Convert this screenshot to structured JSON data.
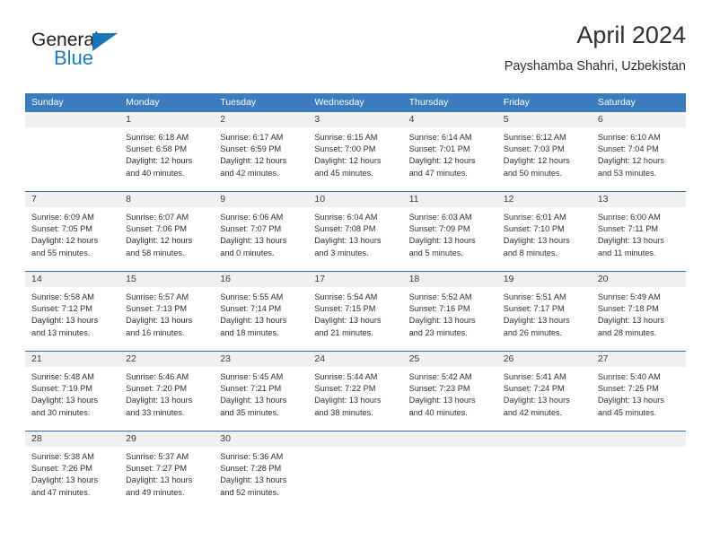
{
  "brand": {
    "name_part1": "General",
    "name_part2": "Blue",
    "accent_color": "#1b72b8"
  },
  "header": {
    "title": "April 2024",
    "subtitle": "Payshamba Shahri, Uzbekistan"
  },
  "calendar": {
    "header_color": "#3a7cbe",
    "weekdays": [
      "Sunday",
      "Monday",
      "Tuesday",
      "Wednesday",
      "Thursday",
      "Friday",
      "Saturday"
    ],
    "weeks": [
      [
        {
          "day": "",
          "sunrise": "",
          "sunset": "",
          "daylight_line1": "",
          "daylight_line2": ""
        },
        {
          "day": "1",
          "sunrise": "Sunrise: 6:18 AM",
          "sunset": "Sunset: 6:58 PM",
          "daylight_line1": "Daylight: 12 hours",
          "daylight_line2": "and 40 minutes."
        },
        {
          "day": "2",
          "sunrise": "Sunrise: 6:17 AM",
          "sunset": "Sunset: 6:59 PM",
          "daylight_line1": "Daylight: 12 hours",
          "daylight_line2": "and 42 minutes."
        },
        {
          "day": "3",
          "sunrise": "Sunrise: 6:15 AM",
          "sunset": "Sunset: 7:00 PM",
          "daylight_line1": "Daylight: 12 hours",
          "daylight_line2": "and 45 minutes."
        },
        {
          "day": "4",
          "sunrise": "Sunrise: 6:14 AM",
          "sunset": "Sunset: 7:01 PM",
          "daylight_line1": "Daylight: 12 hours",
          "daylight_line2": "and 47 minutes."
        },
        {
          "day": "5",
          "sunrise": "Sunrise: 6:12 AM",
          "sunset": "Sunset: 7:03 PM",
          "daylight_line1": "Daylight: 12 hours",
          "daylight_line2": "and 50 minutes."
        },
        {
          "day": "6",
          "sunrise": "Sunrise: 6:10 AM",
          "sunset": "Sunset: 7:04 PM",
          "daylight_line1": "Daylight: 12 hours",
          "daylight_line2": "and 53 minutes."
        }
      ],
      [
        {
          "day": "7",
          "sunrise": "Sunrise: 6:09 AM",
          "sunset": "Sunset: 7:05 PM",
          "daylight_line1": "Daylight: 12 hours",
          "daylight_line2": "and 55 minutes."
        },
        {
          "day": "8",
          "sunrise": "Sunrise: 6:07 AM",
          "sunset": "Sunset: 7:06 PM",
          "daylight_line1": "Daylight: 12 hours",
          "daylight_line2": "and 58 minutes."
        },
        {
          "day": "9",
          "sunrise": "Sunrise: 6:06 AM",
          "sunset": "Sunset: 7:07 PM",
          "daylight_line1": "Daylight: 13 hours",
          "daylight_line2": "and 0 minutes."
        },
        {
          "day": "10",
          "sunrise": "Sunrise: 6:04 AM",
          "sunset": "Sunset: 7:08 PM",
          "daylight_line1": "Daylight: 13 hours",
          "daylight_line2": "and 3 minutes."
        },
        {
          "day": "11",
          "sunrise": "Sunrise: 6:03 AM",
          "sunset": "Sunset: 7:09 PM",
          "daylight_line1": "Daylight: 13 hours",
          "daylight_line2": "and 5 minutes."
        },
        {
          "day": "12",
          "sunrise": "Sunrise: 6:01 AM",
          "sunset": "Sunset: 7:10 PM",
          "daylight_line1": "Daylight: 13 hours",
          "daylight_line2": "and 8 minutes."
        },
        {
          "day": "13",
          "sunrise": "Sunrise: 6:00 AM",
          "sunset": "Sunset: 7:11 PM",
          "daylight_line1": "Daylight: 13 hours",
          "daylight_line2": "and 11 minutes."
        }
      ],
      [
        {
          "day": "14",
          "sunrise": "Sunrise: 5:58 AM",
          "sunset": "Sunset: 7:12 PM",
          "daylight_line1": "Daylight: 13 hours",
          "daylight_line2": "and 13 minutes."
        },
        {
          "day": "15",
          "sunrise": "Sunrise: 5:57 AM",
          "sunset": "Sunset: 7:13 PM",
          "daylight_line1": "Daylight: 13 hours",
          "daylight_line2": "and 16 minutes."
        },
        {
          "day": "16",
          "sunrise": "Sunrise: 5:55 AM",
          "sunset": "Sunset: 7:14 PM",
          "daylight_line1": "Daylight: 13 hours",
          "daylight_line2": "and 18 minutes."
        },
        {
          "day": "17",
          "sunrise": "Sunrise: 5:54 AM",
          "sunset": "Sunset: 7:15 PM",
          "daylight_line1": "Daylight: 13 hours",
          "daylight_line2": "and 21 minutes."
        },
        {
          "day": "18",
          "sunrise": "Sunrise: 5:52 AM",
          "sunset": "Sunset: 7:16 PM",
          "daylight_line1": "Daylight: 13 hours",
          "daylight_line2": "and 23 minutes."
        },
        {
          "day": "19",
          "sunrise": "Sunrise: 5:51 AM",
          "sunset": "Sunset: 7:17 PM",
          "daylight_line1": "Daylight: 13 hours",
          "daylight_line2": "and 26 minutes."
        },
        {
          "day": "20",
          "sunrise": "Sunrise: 5:49 AM",
          "sunset": "Sunset: 7:18 PM",
          "daylight_line1": "Daylight: 13 hours",
          "daylight_line2": "and 28 minutes."
        }
      ],
      [
        {
          "day": "21",
          "sunrise": "Sunrise: 5:48 AM",
          "sunset": "Sunset: 7:19 PM",
          "daylight_line1": "Daylight: 13 hours",
          "daylight_line2": "and 30 minutes."
        },
        {
          "day": "22",
          "sunrise": "Sunrise: 5:46 AM",
          "sunset": "Sunset: 7:20 PM",
          "daylight_line1": "Daylight: 13 hours",
          "daylight_line2": "and 33 minutes."
        },
        {
          "day": "23",
          "sunrise": "Sunrise: 5:45 AM",
          "sunset": "Sunset: 7:21 PM",
          "daylight_line1": "Daylight: 13 hours",
          "daylight_line2": "and 35 minutes."
        },
        {
          "day": "24",
          "sunrise": "Sunrise: 5:44 AM",
          "sunset": "Sunset: 7:22 PM",
          "daylight_line1": "Daylight: 13 hours",
          "daylight_line2": "and 38 minutes."
        },
        {
          "day": "25",
          "sunrise": "Sunrise: 5:42 AM",
          "sunset": "Sunset: 7:23 PM",
          "daylight_line1": "Daylight: 13 hours",
          "daylight_line2": "and 40 minutes."
        },
        {
          "day": "26",
          "sunrise": "Sunrise: 5:41 AM",
          "sunset": "Sunset: 7:24 PM",
          "daylight_line1": "Daylight: 13 hours",
          "daylight_line2": "and 42 minutes."
        },
        {
          "day": "27",
          "sunrise": "Sunrise: 5:40 AM",
          "sunset": "Sunset: 7:25 PM",
          "daylight_line1": "Daylight: 13 hours",
          "daylight_line2": "and 45 minutes."
        }
      ],
      [
        {
          "day": "28",
          "sunrise": "Sunrise: 5:38 AM",
          "sunset": "Sunset: 7:26 PM",
          "daylight_line1": "Daylight: 13 hours",
          "daylight_line2": "and 47 minutes."
        },
        {
          "day": "29",
          "sunrise": "Sunrise: 5:37 AM",
          "sunset": "Sunset: 7:27 PM",
          "daylight_line1": "Daylight: 13 hours",
          "daylight_line2": "and 49 minutes."
        },
        {
          "day": "30",
          "sunrise": "Sunrise: 5:36 AM",
          "sunset": "Sunset: 7:28 PM",
          "daylight_line1": "Daylight: 13 hours",
          "daylight_line2": "and 52 minutes."
        },
        {
          "day": "",
          "sunrise": "",
          "sunset": "",
          "daylight_line1": "",
          "daylight_line2": ""
        },
        {
          "day": "",
          "sunrise": "",
          "sunset": "",
          "daylight_line1": "",
          "daylight_line2": ""
        },
        {
          "day": "",
          "sunrise": "",
          "sunset": "",
          "daylight_line1": "",
          "daylight_line2": ""
        },
        {
          "day": "",
          "sunrise": "",
          "sunset": "",
          "daylight_line1": "",
          "daylight_line2": ""
        }
      ]
    ]
  }
}
